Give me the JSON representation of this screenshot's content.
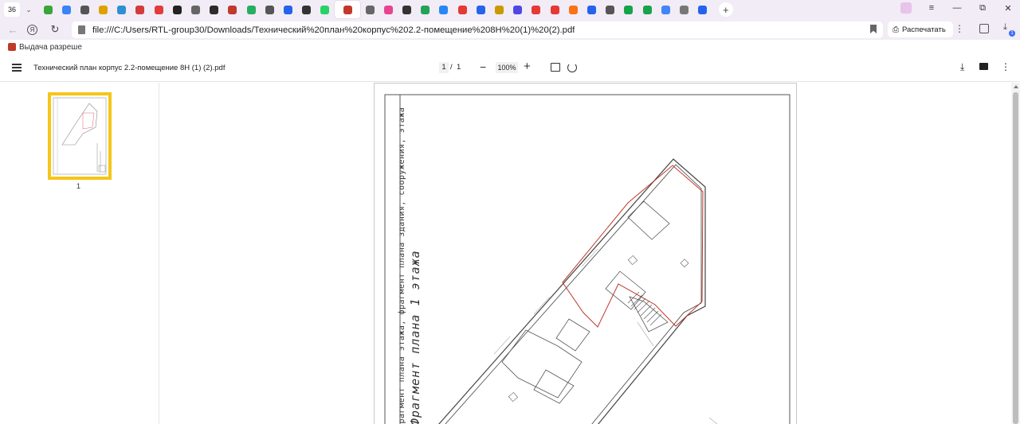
{
  "tabbar": {
    "tab_count": "36",
    "tab_icon_colors": [
      "#3aa53a",
      "#3b82f6",
      "#555555",
      "#e0a000",
      "#2f8fd1",
      "#d33a3a",
      "#e23b3b",
      "#222222",
      "#666666",
      "#2b2b2b",
      "#c0392b",
      "#27ae60",
      "#555555",
      "#2563eb",
      "#333333",
      "#25d366",
      "#c0392b",
      "#666666",
      "#e84393",
      "#333333",
      "#22a35a",
      "#2787f5",
      "#e53935",
      "#2563eb",
      "#c89a00",
      "#4f46e5",
      "#e53935",
      "#e53935",
      "#f97316",
      "#2563eb",
      "#555555",
      "#16a34a",
      "#16a34a",
      "#4285f4",
      "#777777",
      "#2563eb"
    ],
    "active_index": 16,
    "new_tab_label": "+",
    "window_buttons": [
      "≡",
      "—",
      "⧉",
      "✕"
    ]
  },
  "addressbar": {
    "back": "←",
    "yandex": "Я",
    "reload": "↻",
    "url": "file:///C:/Users/RTL-group30/Downloads/Технический%20план%20корпус%202.2-помещение%208Н%20(1)%20(2).pdf",
    "print_label": "Распечатать",
    "more": "⋮",
    "downloads_badge": "1"
  },
  "bookmarks": {
    "items": [
      {
        "label": "Выдача разреше"
      }
    ]
  },
  "pdf_toolbar": {
    "title": "Технический план корпус 2.2-помещение 8Н (1) (2).pdf",
    "page_current": "1",
    "page_sep": "/",
    "page_total": "1",
    "zoom_out": "−",
    "zoom": "100%",
    "zoom_in": "+",
    "download": "⤓",
    "more": "⋮"
  },
  "sidebar": {
    "thumb_page": "1"
  },
  "document": {
    "vertical_caption": "Фрагмент плана этажа, фрагмент плана здания, сооружения, этажа",
    "vertical_caption_large": "Фрагмент плана 1 этажа"
  }
}
